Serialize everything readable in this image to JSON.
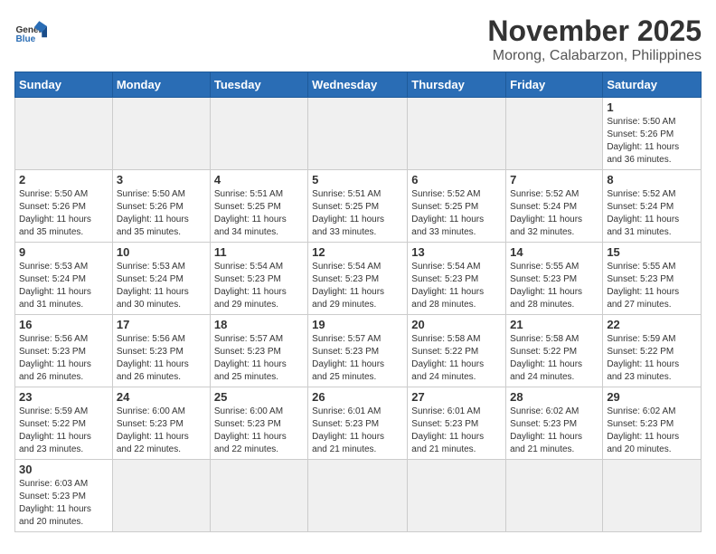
{
  "header": {
    "logo_text_general": "General",
    "logo_text_blue": "Blue",
    "month_title": "November 2025",
    "location": "Morong, Calabarzon, Philippines"
  },
  "days_of_week": [
    "Sunday",
    "Monday",
    "Tuesday",
    "Wednesday",
    "Thursday",
    "Friday",
    "Saturday"
  ],
  "weeks": [
    [
      {
        "day": "",
        "info": ""
      },
      {
        "day": "",
        "info": ""
      },
      {
        "day": "",
        "info": ""
      },
      {
        "day": "",
        "info": ""
      },
      {
        "day": "",
        "info": ""
      },
      {
        "day": "",
        "info": ""
      },
      {
        "day": "1",
        "info": "Sunrise: 5:50 AM\nSunset: 5:26 PM\nDaylight: 11 hours\nand 36 minutes."
      }
    ],
    [
      {
        "day": "2",
        "info": "Sunrise: 5:50 AM\nSunset: 5:26 PM\nDaylight: 11 hours\nand 35 minutes."
      },
      {
        "day": "3",
        "info": "Sunrise: 5:50 AM\nSunset: 5:26 PM\nDaylight: 11 hours\nand 35 minutes."
      },
      {
        "day": "4",
        "info": "Sunrise: 5:51 AM\nSunset: 5:25 PM\nDaylight: 11 hours\nand 34 minutes."
      },
      {
        "day": "5",
        "info": "Sunrise: 5:51 AM\nSunset: 5:25 PM\nDaylight: 11 hours\nand 33 minutes."
      },
      {
        "day": "6",
        "info": "Sunrise: 5:52 AM\nSunset: 5:25 PM\nDaylight: 11 hours\nand 33 minutes."
      },
      {
        "day": "7",
        "info": "Sunrise: 5:52 AM\nSunset: 5:24 PM\nDaylight: 11 hours\nand 32 minutes."
      },
      {
        "day": "8",
        "info": "Sunrise: 5:52 AM\nSunset: 5:24 PM\nDaylight: 11 hours\nand 31 minutes."
      }
    ],
    [
      {
        "day": "9",
        "info": "Sunrise: 5:53 AM\nSunset: 5:24 PM\nDaylight: 11 hours\nand 31 minutes."
      },
      {
        "day": "10",
        "info": "Sunrise: 5:53 AM\nSunset: 5:24 PM\nDaylight: 11 hours\nand 30 minutes."
      },
      {
        "day": "11",
        "info": "Sunrise: 5:54 AM\nSunset: 5:23 PM\nDaylight: 11 hours\nand 29 minutes."
      },
      {
        "day": "12",
        "info": "Sunrise: 5:54 AM\nSunset: 5:23 PM\nDaylight: 11 hours\nand 29 minutes."
      },
      {
        "day": "13",
        "info": "Sunrise: 5:54 AM\nSunset: 5:23 PM\nDaylight: 11 hours\nand 28 minutes."
      },
      {
        "day": "14",
        "info": "Sunrise: 5:55 AM\nSunset: 5:23 PM\nDaylight: 11 hours\nand 28 minutes."
      },
      {
        "day": "15",
        "info": "Sunrise: 5:55 AM\nSunset: 5:23 PM\nDaylight: 11 hours\nand 27 minutes."
      }
    ],
    [
      {
        "day": "16",
        "info": "Sunrise: 5:56 AM\nSunset: 5:23 PM\nDaylight: 11 hours\nand 26 minutes."
      },
      {
        "day": "17",
        "info": "Sunrise: 5:56 AM\nSunset: 5:23 PM\nDaylight: 11 hours\nand 26 minutes."
      },
      {
        "day": "18",
        "info": "Sunrise: 5:57 AM\nSunset: 5:23 PM\nDaylight: 11 hours\nand 25 minutes."
      },
      {
        "day": "19",
        "info": "Sunrise: 5:57 AM\nSunset: 5:23 PM\nDaylight: 11 hours\nand 25 minutes."
      },
      {
        "day": "20",
        "info": "Sunrise: 5:58 AM\nSunset: 5:22 PM\nDaylight: 11 hours\nand 24 minutes."
      },
      {
        "day": "21",
        "info": "Sunrise: 5:58 AM\nSunset: 5:22 PM\nDaylight: 11 hours\nand 24 minutes."
      },
      {
        "day": "22",
        "info": "Sunrise: 5:59 AM\nSunset: 5:22 PM\nDaylight: 11 hours\nand 23 minutes."
      }
    ],
    [
      {
        "day": "23",
        "info": "Sunrise: 5:59 AM\nSunset: 5:22 PM\nDaylight: 11 hours\nand 23 minutes."
      },
      {
        "day": "24",
        "info": "Sunrise: 6:00 AM\nSunset: 5:23 PM\nDaylight: 11 hours\nand 22 minutes."
      },
      {
        "day": "25",
        "info": "Sunrise: 6:00 AM\nSunset: 5:23 PM\nDaylight: 11 hours\nand 22 minutes."
      },
      {
        "day": "26",
        "info": "Sunrise: 6:01 AM\nSunset: 5:23 PM\nDaylight: 11 hours\nand 21 minutes."
      },
      {
        "day": "27",
        "info": "Sunrise: 6:01 AM\nSunset: 5:23 PM\nDaylight: 11 hours\nand 21 minutes."
      },
      {
        "day": "28",
        "info": "Sunrise: 6:02 AM\nSunset: 5:23 PM\nDaylight: 11 hours\nand 21 minutes."
      },
      {
        "day": "29",
        "info": "Sunrise: 6:02 AM\nSunset: 5:23 PM\nDaylight: 11 hours\nand 20 minutes."
      }
    ],
    [
      {
        "day": "30",
        "info": "Sunrise: 6:03 AM\nSunset: 5:23 PM\nDaylight: 11 hours\nand 20 minutes."
      },
      {
        "day": "",
        "info": ""
      },
      {
        "day": "",
        "info": ""
      },
      {
        "day": "",
        "info": ""
      },
      {
        "day": "",
        "info": ""
      },
      {
        "day": "",
        "info": ""
      },
      {
        "day": "",
        "info": ""
      }
    ]
  ]
}
